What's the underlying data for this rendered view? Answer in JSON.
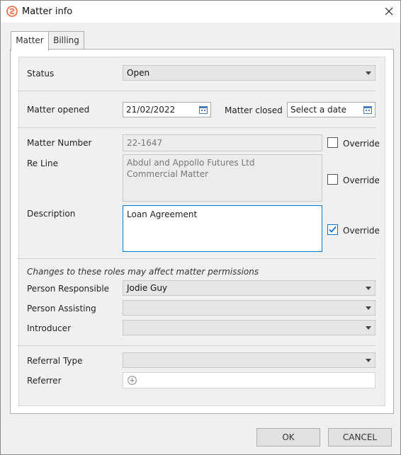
{
  "window": {
    "title": "Matter info"
  },
  "tabs": [
    {
      "label": "Matter"
    },
    {
      "label": "Billing"
    }
  ],
  "status": {
    "label": "Status",
    "value": "Open"
  },
  "dates": {
    "opened_label": "Matter opened",
    "opened_value": "21/02/2022",
    "closed_label": "Matter closed",
    "closed_placeholder": "Select a date"
  },
  "matter_number": {
    "label": "Matter Number",
    "value": "22-1647",
    "override_label": "Override",
    "override_checked": false
  },
  "re_line": {
    "label": "Re Line",
    "value": "Abdul and Appollo Futures Ltd\nCommercial Matter",
    "override_label": "Override",
    "override_checked": false
  },
  "description": {
    "label": "Description",
    "value": "Loan Agreement",
    "override_label": "Override",
    "override_checked": true
  },
  "roles": {
    "note": "Changes to these roles may affect matter permissions",
    "person_responsible": {
      "label": "Person Responsible",
      "value": "Jodie Guy"
    },
    "person_assisting": {
      "label": "Person Assisting",
      "value": ""
    },
    "introducer": {
      "label": "Introducer",
      "value": ""
    }
  },
  "referral": {
    "type_label": "Referral Type",
    "type_value": "",
    "referrer_label": "Referrer"
  },
  "buttons": {
    "ok": "OK",
    "cancel": "CANCEL"
  },
  "colors": {
    "accent": "#0078d7",
    "app_icon": "#e8663d",
    "check": "#1a6fc9"
  }
}
